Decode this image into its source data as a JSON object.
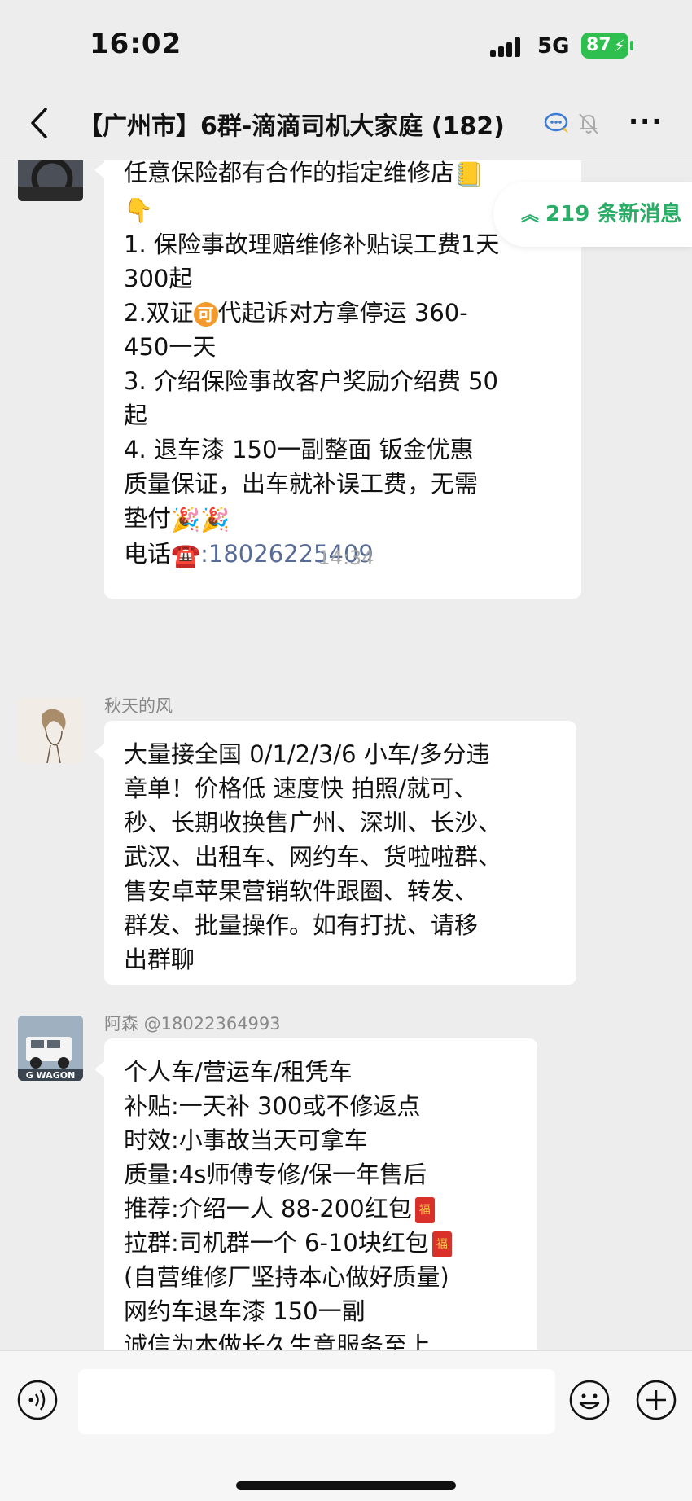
{
  "status_bar": {
    "time": "16:02",
    "network": "5G",
    "battery": "87"
  },
  "header": {
    "title": "【广州市】6群-滴滴司机大家庭 (182)",
    "back_icon": "chevron-left-icon",
    "more_label": "···"
  },
  "new_messages": {
    "label": "219 条新消息",
    "icon": "double-chevron-up-icon"
  },
  "messages": [
    {
      "lines": [
        "任意保险都有合作的指定维修店",
        "1. 保险事故理赔维修补贴误工费1天",
        "300起",
        "2.双证",
        "代起诉对方拿停运 360-",
        "450一天",
        "3. 介绍保险事故客户奖励介绍费 50",
        "起",
        "4. 退车漆 150一副整面 钣金优惠",
        "质量保证，出车就补误工费，无需",
        "垫付",
        "电话",
        ":18026225409"
      ],
      "emojis": {
        "point": "👇",
        "badge": "可",
        "party": "🎉🎉",
        "phone": "☎️"
      }
    },
    {
      "timestamp": "14:34",
      "sender": "秋天的风",
      "lines": [
        "大量接全国 0/1/2/3/6 小车/多分违",
        "章单！价格低 速度快 拍照/就可、",
        "秒、长期收换售广州、深圳、长沙、",
        "武汉、出租车、网约车、货啦啦群、",
        "售安卓苹果营销软件跟圈、转发、",
        "群发、批量操作。如有打扰、请移",
        "出群聊"
      ]
    },
    {
      "sender": "阿森 @18022364993",
      "avatar_caption": "G WAGON",
      "lines": [
        "个人车/营运车/租凭车",
        "补贴:一天补 300或不修返点",
        "时效:小事故当天可拿车",
        "质量:4s师傅专修/保一年售后",
        "推荐:介绍一人 88-200红包",
        "拉群:司机群一个 6-10块红包",
        "(自营维修厂坚持本心做好质量)",
        "网约车退车漆 150一副",
        "诚信为本做长久生意服务至上"
      ],
      "emojis": {
        "redpacket": "福"
      }
    }
  ],
  "input_bar": {
    "placeholder": ""
  }
}
